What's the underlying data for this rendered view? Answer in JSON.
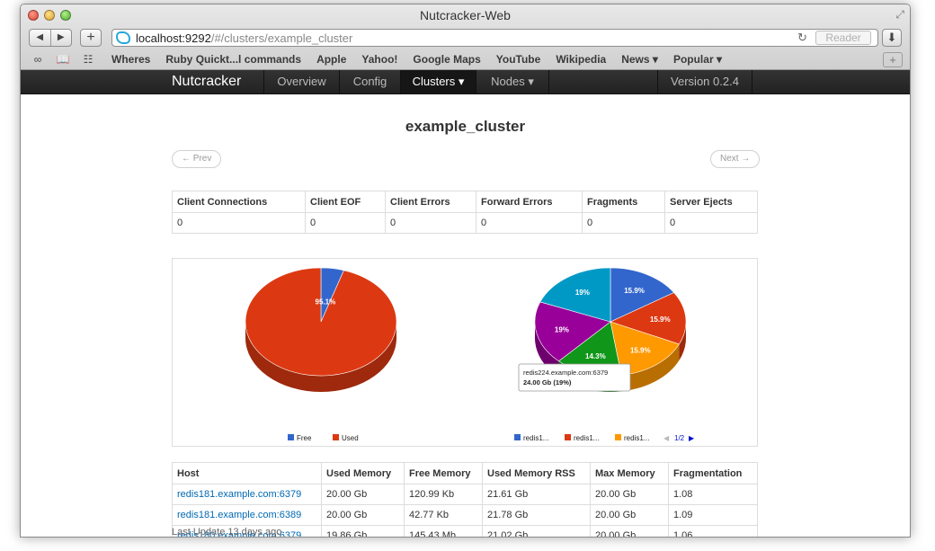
{
  "window": {
    "title": "Nutcracker-Web"
  },
  "toolbar": {
    "back_icon": "back-arrow-icon",
    "forward_icon": "forward-arrow-icon",
    "new_tab": "+",
    "reload_icon": "reload-icon",
    "reader_label": "Reader",
    "download_icon": "download-icon"
  },
  "url": {
    "host": "localhost:9292",
    "path": "/#/clusters/example_cluster"
  },
  "bookmarks": [
    "Wheres",
    "Ruby Quickt...l commands",
    "Apple",
    "Yahoo!",
    "Google Maps",
    "YouTube",
    "Wikipedia",
    "News ▾",
    "Popular ▾"
  ],
  "navbar": {
    "brand": "Nutcracker",
    "items": [
      {
        "label": "Overview"
      },
      {
        "label": "Config"
      },
      {
        "label": "Clusters ▾"
      },
      {
        "label": "Nodes ▾"
      }
    ],
    "active_index": 2,
    "version": "Version 0.2.4"
  },
  "page": {
    "title": "example_cluster",
    "prev_label": "← Prev",
    "next_label": "Next →"
  },
  "stats": {
    "headers": [
      "Client Connections",
      "Client EOF",
      "Client Errors",
      "Forward Errors",
      "Fragments",
      "Server Ejects"
    ],
    "values": [
      "0",
      "0",
      "0",
      "0",
      "0",
      "0"
    ]
  },
  "chart_data": [
    {
      "type": "pie",
      "slices": [
        {
          "label": "Free",
          "value": 4.9,
          "color": "#3366cc"
        },
        {
          "label": "Used",
          "value": 95.1,
          "color": "#dc3912"
        }
      ],
      "data_labels": [
        "95.1%"
      ],
      "legend": [
        "Free",
        "Used"
      ]
    },
    {
      "type": "pie",
      "slices": [
        {
          "label": "redis1...",
          "value": 15.9,
          "color": "#3366cc"
        },
        {
          "label": "redis1...",
          "value": 15.9,
          "color": "#dc3912"
        },
        {
          "label": "redis1...",
          "value": 15.9,
          "color": "#ff9900"
        },
        {
          "label": "",
          "value": 14.3,
          "color": "#109618"
        },
        {
          "label": "",
          "value": 19,
          "color": "#990099"
        },
        {
          "label": "",
          "value": 19,
          "color": "#0099c6"
        }
      ],
      "data_labels": [
        "15.9%",
        "15.9%",
        "15.9%",
        "14.3%",
        "19%",
        "19%"
      ],
      "legend": [
        "redis1...",
        "redis1...",
        "redis1..."
      ],
      "legend_page": "1/2",
      "tooltip": {
        "host": "redis224.example.com:6379",
        "value": "24.00 Gb (19%)"
      }
    }
  ],
  "hosts": {
    "headers": [
      "Host",
      "Used Memory",
      "Free Memory",
      "Used Memory RSS",
      "Max Memory",
      "Fragmentation"
    ],
    "rows": [
      [
        "redis181.example.com:6379",
        "20.00 Gb",
        "120.99 Kb",
        "21.61 Gb",
        "20.00 Gb",
        "1.08"
      ],
      [
        "redis181.example.com:6389",
        "20.00 Gb",
        "42.77 Kb",
        "21.78 Gb",
        "20.00 Gb",
        "1.09"
      ],
      [
        "redis180.example.com:6379",
        "19.86 Gb",
        "145.43 Mb",
        "21.02 Gb",
        "20.00 Gb",
        "1.06"
      ]
    ]
  },
  "footer": {
    "last_update": "Last Update 13 days ago"
  }
}
